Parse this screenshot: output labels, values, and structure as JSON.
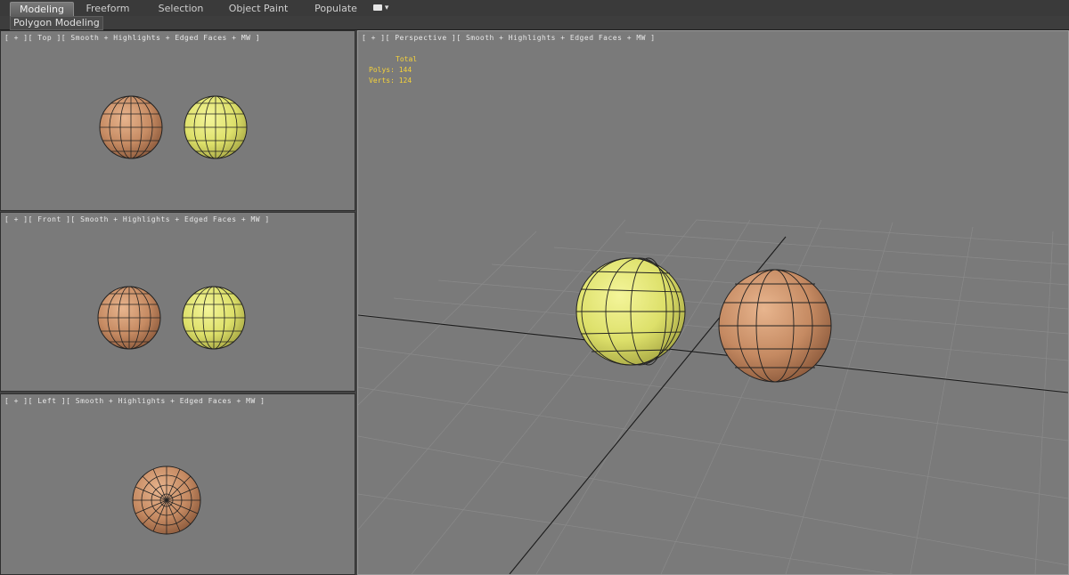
{
  "ribbon": {
    "tabs": [
      {
        "label": "Modeling",
        "active": true
      },
      {
        "label": "Freeform",
        "active": false
      },
      {
        "label": "Selection",
        "active": false
      },
      {
        "label": "Object Paint",
        "active": false
      },
      {
        "label": "Populate",
        "active": false
      }
    ],
    "panel_label": "Polygon Modeling"
  },
  "viewports": {
    "top": {
      "label": "[ + ][ Top ][ Smooth + Highlights + Edged Faces + MW ]"
    },
    "front": {
      "label": "[ + ][ Front ][ Smooth + Highlights + Edged Faces + MW ]"
    },
    "left": {
      "label": "[ + ][ Left ][ Smooth + Highlights + Edged Faces + MW ]"
    },
    "perspective": {
      "label": "[ + ][ Perspective ][ Smooth + Highlights + Edged Faces + MW ]"
    }
  },
  "stats": {
    "total": "Total",
    "polys": "Polys: 144",
    "verts": "Verts: 124"
  },
  "colors": {
    "viewport_bg": "#7a7a7a",
    "sphere_brown": "#c9906a",
    "sphere_yellow": "#dfe472",
    "stats_text": "#f5d23a"
  }
}
